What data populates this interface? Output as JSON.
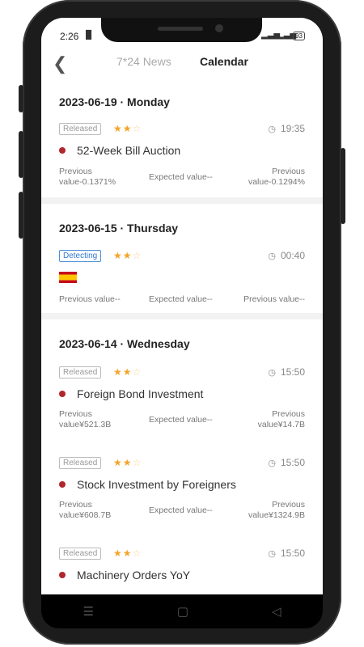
{
  "status_bar": {
    "time": "2:26",
    "battery": "93"
  },
  "header": {
    "tab_news": "7*24 News",
    "tab_calendar": "Calendar"
  },
  "sections": [
    {
      "date": "2023-06-19 · Monday",
      "items": [
        {
          "badge": "Released",
          "stars": 2,
          "time": "19:35",
          "event": "52-Week Bill Auction",
          "prev": [
            "Previous",
            "value-0.1371%"
          ],
          "expected": "Expected value--",
          "next": [
            "Previous",
            "value-0.1294%"
          ]
        }
      ]
    },
    {
      "date": "2023-06-15 · Thursday",
      "items": [
        {
          "badge": "Detecting",
          "stars": 2,
          "time": "00:40",
          "event": "",
          "prev": [
            "Previous value--"
          ],
          "expected": "Expected value--",
          "next": [
            "Previous value--"
          ]
        }
      ]
    },
    {
      "date": "2023-06-14 · Wednesday",
      "items": [
        {
          "badge": "Released",
          "stars": 2,
          "time": "15:50",
          "event": "Foreign Bond Investment",
          "prev": [
            "Previous",
            "value¥521.3B"
          ],
          "expected": "Expected value--",
          "next": [
            "Previous",
            "value¥14.7B"
          ]
        },
        {
          "badge": "Released",
          "stars": 2,
          "time": "15:50",
          "event": "Stock Investment by Foreigners",
          "prev": [
            "Previous",
            "value¥608.7B"
          ],
          "expected": "Expected value--",
          "next": [
            "Previous",
            "value¥1324.9B"
          ]
        },
        {
          "badge": "Released",
          "stars": 2,
          "time": "15:50",
          "event": "Machinery Orders YoY"
        }
      ]
    }
  ]
}
